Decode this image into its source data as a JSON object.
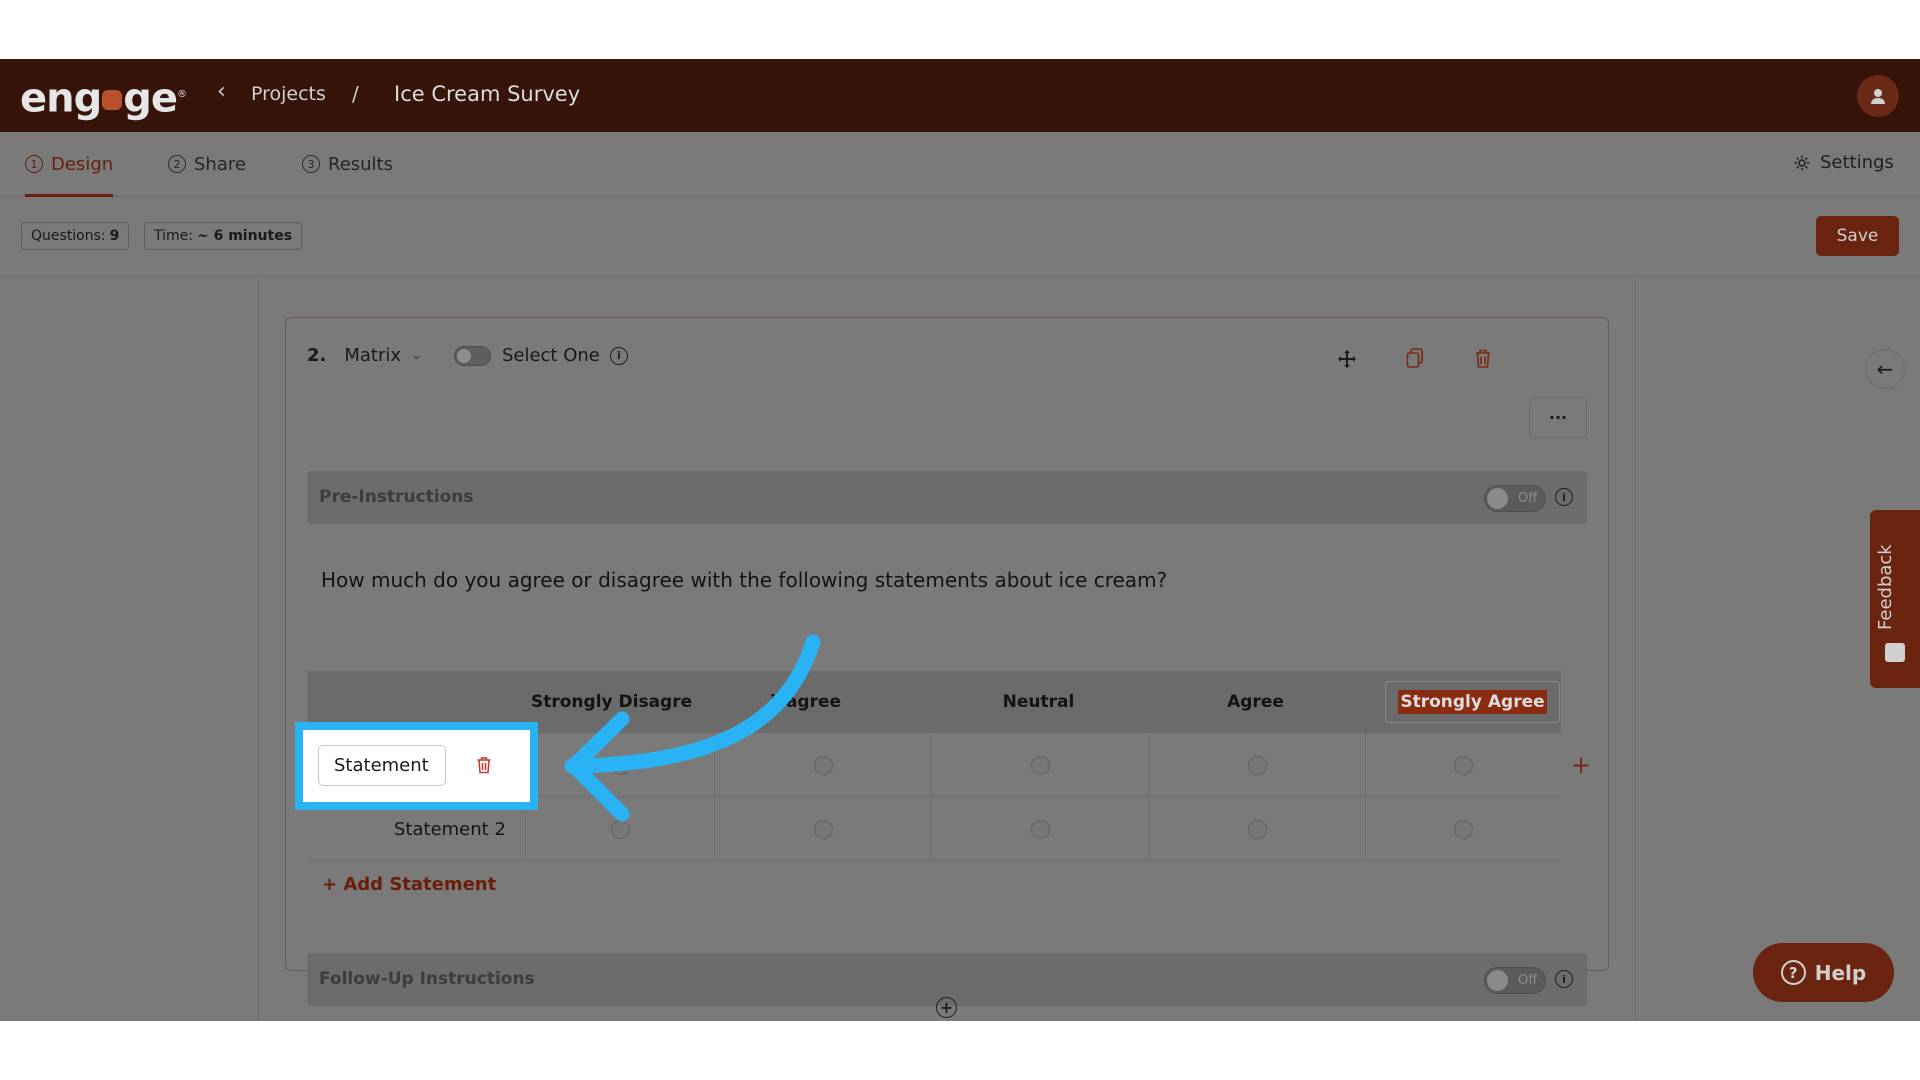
{
  "header": {
    "logo_text": "eng",
    "logo_text_end": "ge",
    "logo_mark": "®",
    "back_icon": "chevron-left-icon",
    "breadcrumb_projects": "Projects",
    "breadcrumb_separator": "/",
    "project_title": "Ice Cream Survey",
    "avatar_icon": "user-icon"
  },
  "tabs": [
    {
      "num": "1",
      "label": "Design",
      "active": true
    },
    {
      "num": "2",
      "label": "Share",
      "active": false
    },
    {
      "num": "3",
      "label": "Results",
      "active": false
    }
  ],
  "settings_label": "Settings",
  "info": {
    "questions_label": "Questions:",
    "questions_value": "9",
    "time_label": "Time:",
    "time_value": "~ 6 minutes"
  },
  "save_label": "Save",
  "question": {
    "number": "2.",
    "type": "Matrix",
    "select_one_label": "Select One",
    "pre_instructions_label": "Pre-Instructions",
    "pre_instructions_toggle": "Off",
    "text": "How much do you agree or disagree with the following statements about ice cream?",
    "columns": [
      "Strongly Disagre",
      "isagree",
      "Neutral",
      "Agree",
      "Strongly Agree"
    ],
    "statements": [
      {
        "label": "Statement",
        "editing": true
      },
      {
        "label": "Statement 2",
        "editing": false
      }
    ],
    "add_statement_label": "+ Add Statement",
    "follow_up_label": "Follow-Up Instructions",
    "follow_up_toggle": "Off"
  },
  "feedback_label": "Feedback",
  "help_label": "Help",
  "colors": {
    "brand_dark": "#361409",
    "accent": "#6b2410",
    "highlight": "#29b3f5"
  }
}
